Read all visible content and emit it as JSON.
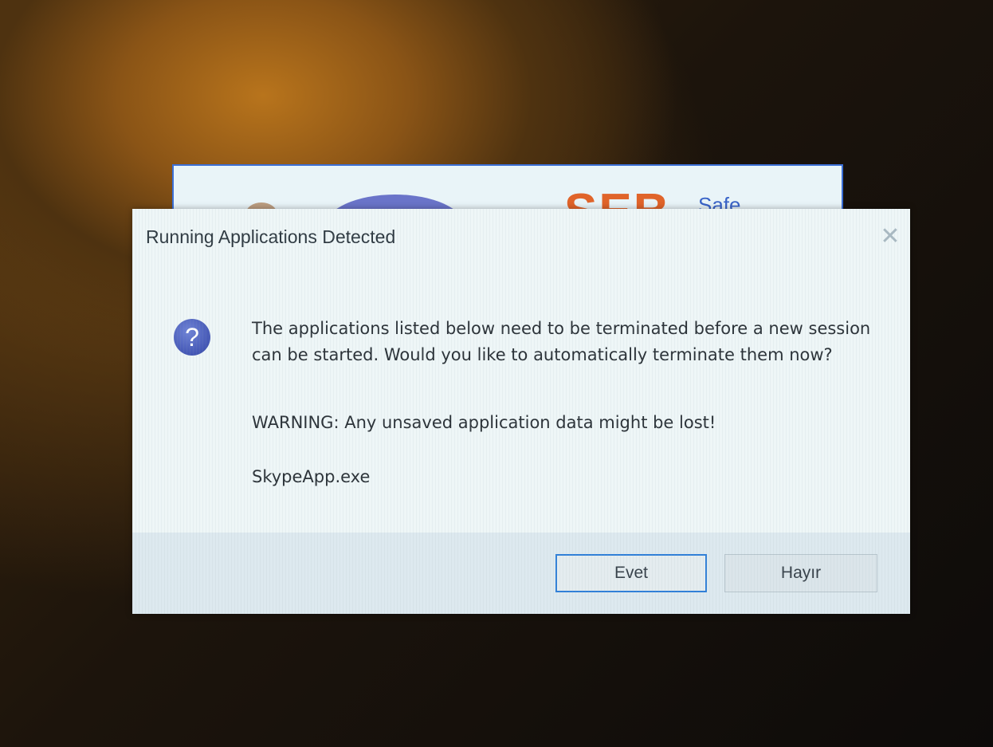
{
  "background_window": {
    "logo_text": "SEB",
    "tagline": "Safe"
  },
  "dialog": {
    "title": "Running Applications Detected",
    "close_glyph": "✕",
    "icon": "question-icon",
    "icon_glyph": "?",
    "message": "The applications listed below need to be terminated before a new session can be started. Would you like to automatically terminate them now?",
    "warning": "WARNING: Any unsaved application data might be lost!",
    "applications": [
      "SkypeApp.exe"
    ],
    "buttons": {
      "yes_label": "Evet",
      "no_label": "Hayır"
    }
  },
  "colors": {
    "accent_border": "#2f7fd8",
    "icon_blue": "#4457b5",
    "logo_orange": "#e0642a"
  }
}
